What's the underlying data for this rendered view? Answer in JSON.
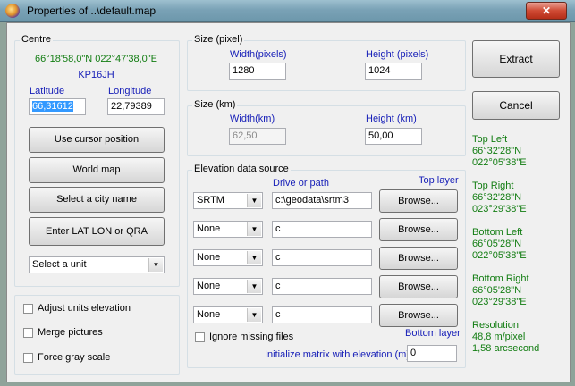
{
  "window": {
    "title": "Properties of ..\\default.map",
    "close_label": "✕"
  },
  "centre": {
    "group_label": "Centre",
    "coords": "66°18'58,0\"N 022°47'38,0\"E",
    "locator": "KP16JH",
    "latitude_label": "Latitude",
    "longitude_label": "Longitude",
    "latitude_value": "66,31612",
    "longitude_value": "22,79389"
  },
  "buttons": {
    "use_cursor": "Use cursor position",
    "world_map": "World map",
    "city": "Select a city name",
    "latlon": "Enter LAT LON or QRA",
    "extract": "Extract",
    "cancel": "Cancel"
  },
  "unit_select": {
    "value": "Select a unit"
  },
  "options": {
    "adjust": "Adjust units elevation",
    "merge": "Merge pictures",
    "gray": "Force gray scale"
  },
  "size_pixel": {
    "group_label": "Size (pixel)",
    "width_label": "Width(pixels)",
    "height_label": "Height (pixels)",
    "width_value": "1280",
    "height_value": "1024"
  },
  "size_km": {
    "group_label": "Size (km)",
    "width_label": "Width(km)",
    "height_label": "Height (km)",
    "width_value": "62,50",
    "height_value": "50,00"
  },
  "elevation": {
    "group_label": "Elevation data source",
    "drive_label": "Drive or path",
    "top_layer": "Top layer",
    "bottom_layer": "Bottom layer",
    "browse_label": "Browse...",
    "rows": [
      {
        "source": "SRTM",
        "path": "c:\\geodata\\srtm3"
      },
      {
        "source": "None",
        "path": "c"
      },
      {
        "source": "None",
        "path": "c"
      },
      {
        "source": "None",
        "path": "c"
      },
      {
        "source": "None",
        "path": "c"
      }
    ],
    "ignore_label": "Ignore missing files",
    "init_label": "Initialize matrix with elevation (m)",
    "init_value": "0"
  },
  "corners": {
    "top_left_label": "Top Left",
    "top_left_lat": "66°32'28\"N",
    "top_left_lon": "022°05'38\"E",
    "top_right_label": "Top Right",
    "top_right_lat": "66°32'28\"N",
    "top_right_lon": "023°29'38\"E",
    "bottom_left_label": "Bottom Left",
    "bottom_left_lat": "66°05'28\"N",
    "bottom_left_lon": "022°05'38\"E",
    "bottom_right_label": "Bottom Right",
    "bottom_right_lat": "66°05'28\"N",
    "bottom_right_lon": "023°29'38\"E",
    "resolution_label": "Resolution",
    "resolution_m": "48,8 m/pixel",
    "resolution_arc": "1,58 arcsecond"
  }
}
